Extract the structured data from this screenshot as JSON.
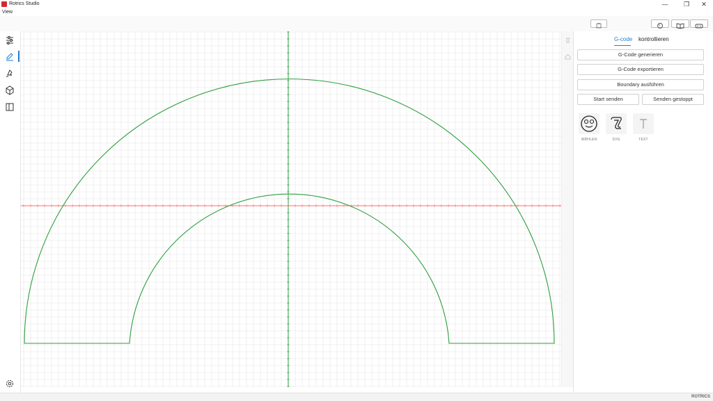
{
  "app": {
    "title": "Rotrics Studio"
  },
  "menu": {
    "items": [
      "View"
    ]
  },
  "window_controls": {
    "minimize": "—",
    "restore": "❐",
    "close": "✕"
  },
  "sidebar": {
    "items": [
      {
        "icon": "sliders-icon",
        "active": false
      },
      {
        "icon": "pen-icon",
        "active": true
      },
      {
        "icon": "laser-icon",
        "active": false
      },
      {
        "icon": "cube-icon",
        "active": false
      },
      {
        "icon": "book-icon",
        "active": false
      }
    ],
    "bottom_icon": "gear-icon"
  },
  "canvas": {
    "grid_color": "#e4e4e4",
    "x_axis_color": "#ff6b6b",
    "y_axis_color": "#2e9e3e",
    "drawing_color": "#2e9e3e"
  },
  "panel": {
    "tabs": [
      {
        "label": "G-code",
        "active": true
      },
      {
        "label": "kontrollieren",
        "active": false
      }
    ],
    "buttons": {
      "generate": "G-Code generieren",
      "export": "G-Code exportieren",
      "boundary": "Boundary ausführen",
      "start": "Start senden",
      "stop": "Senden gestoppt"
    },
    "tiles": [
      {
        "label": "WÄHLEN",
        "icon": "smiley-icon"
      },
      {
        "label": "SVG",
        "icon": "svg-icon"
      },
      {
        "label": "TEXT",
        "icon": "text-icon"
      }
    ]
  },
  "status": {
    "brand": "ROTRICS"
  },
  "accent_color": "#1e7fd1"
}
